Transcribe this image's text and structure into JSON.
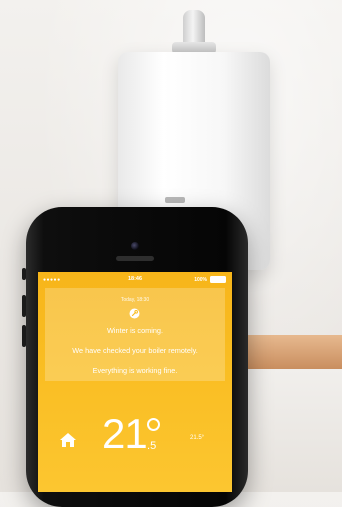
{
  "status_bar": {
    "signal": "●●●●●",
    "time": "18:46",
    "battery": "100%"
  },
  "notification": {
    "date": "Today, 18:30",
    "lines": [
      "Winter is coming.",
      "We have checked your boiler remotely.",
      "Everything is working fine."
    ]
  },
  "temperature": {
    "current_whole": "21",
    "current_decimal": "5",
    "target": "21.5°"
  },
  "colors": {
    "screen_bg": "#f9bd22",
    "text": "#ffffff"
  },
  "icons": {
    "notification": "wrench-icon",
    "home": "home-icon",
    "battery": "battery-icon"
  }
}
